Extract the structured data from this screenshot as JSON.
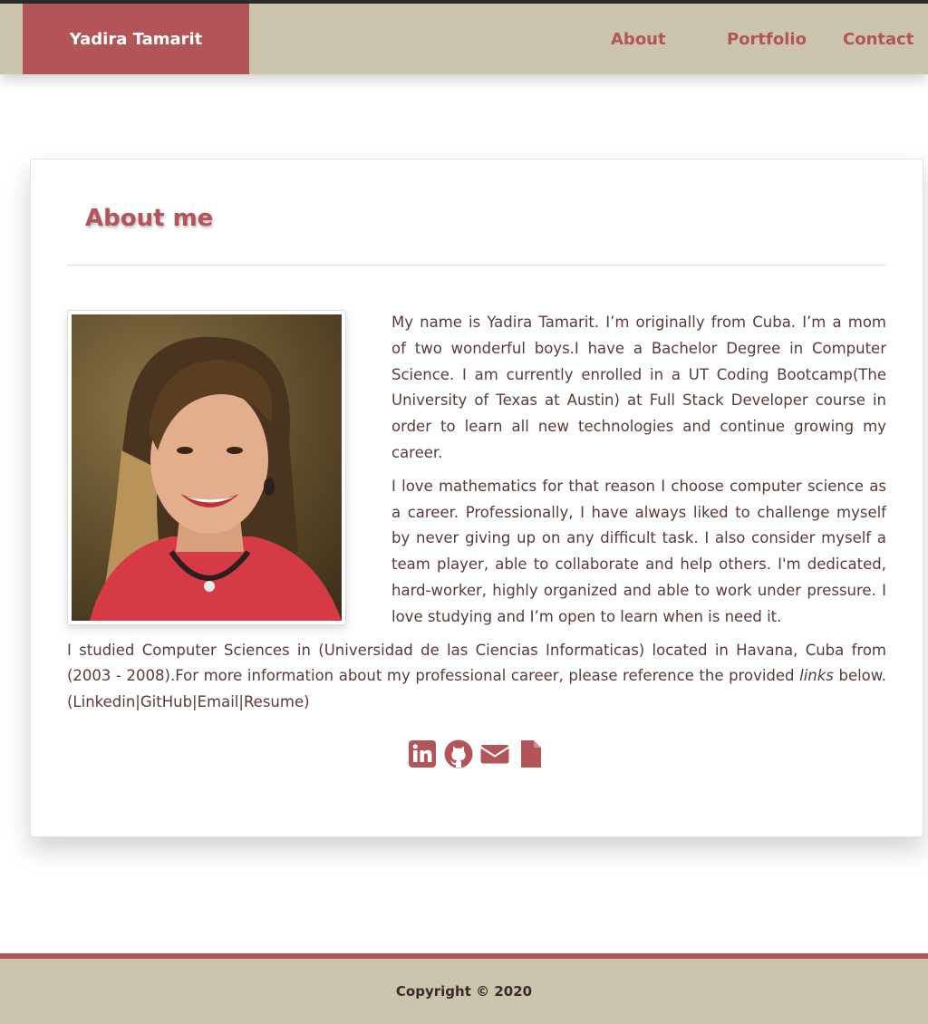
{
  "brand": "Yadira Tamarit",
  "nav": {
    "about": "About",
    "portfolio": "Portfolio",
    "contact": "Contact"
  },
  "card": {
    "title": "About me",
    "p1": "My name is Yadira Tamarit. I’m originally from Cuba. I’m a mom of two wonderful boys.I have a Bachelor Degree in Computer Science. I am currently enrolled in a UT Coding Bootcamp(The University of Texas at Austin) at Full Stack Developer course in order to learn all new technologies and continue growing my career.",
    "p2": "I love mathematics for that reason I choose computer science as a career. Professionally, I have always liked to challenge myself by never giving up on any difficult task. I also consider myself a team player, able to collaborate and help others. I'm dedicated, hard-worker, highly organized and able to work under pressure. I love studying and I’m open to learn when is need it.",
    "p3_before": "I studied Computer Sciences in (Universidad de las Ciencias Informaticas) located in Havana, Cuba from (2003 - 2008).For more information about my professional career, please reference the provided ",
    "p3_em": "links",
    "p3_after": " below.(Linkedin|GitHub|Email|Resume)"
  },
  "icons": [
    "linkedin-icon",
    "github-icon",
    "envelope-icon",
    "file-icon"
  ],
  "footer": "Copyright © 2020",
  "colors": {
    "accent": "#b35458",
    "nav_bg": "#cbc5ae",
    "text": "#5a3a3a"
  }
}
